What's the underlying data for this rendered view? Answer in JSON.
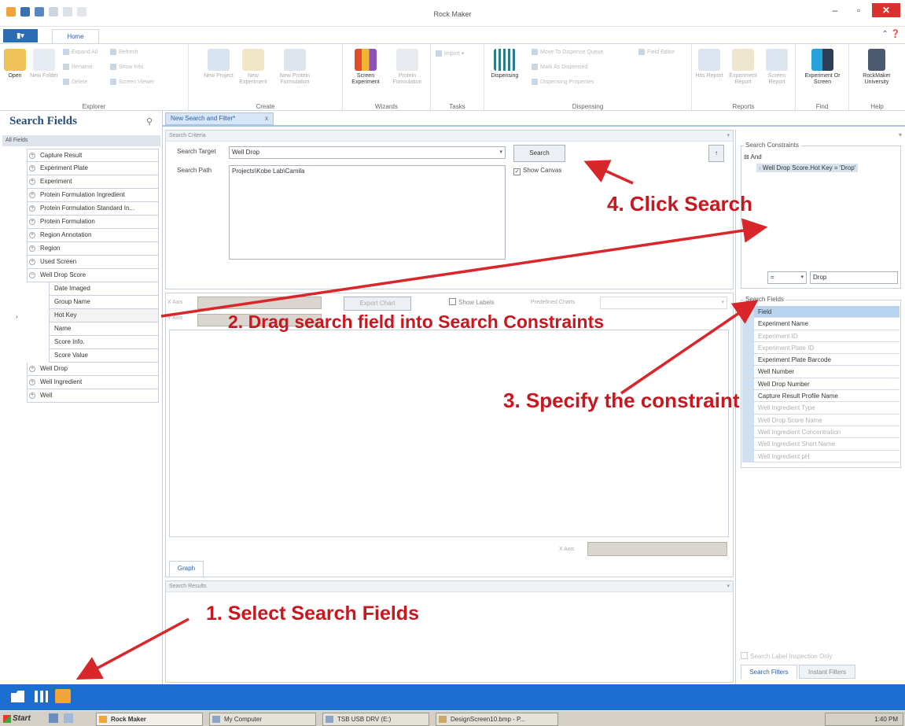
{
  "window": {
    "title": "Rock Maker"
  },
  "ribbon": {
    "file_tab": "",
    "home_tab": "Home",
    "groups": [
      {
        "label": "Explorer"
      },
      {
        "label": "Create"
      },
      {
        "label": "Wizards"
      },
      {
        "label": "Tasks"
      },
      {
        "label": "Dispensing"
      },
      {
        "label": "Reports"
      },
      {
        "label": "Find"
      },
      {
        "label": "Help"
      }
    ],
    "buttons": {
      "open": "Open",
      "new_folder": "New Folder",
      "expand_all": "Expand All",
      "refresh": "Refresh",
      "rename": "Rename",
      "show_info": "Show Info",
      "delete": "Delete",
      "screen_viewer": "Screen Viewer",
      "new_project": "New Project",
      "new_experiment": "New Experiment",
      "new_protein_formulation": "New Protein Formulation",
      "screen_experiment": "Screen Experiment",
      "protein_formulation": "Protein Formulation",
      "import": "Import",
      "dispensing": "Dispensing",
      "move_to_dispense_queue": "Move To Dispense Queue",
      "mark_as_dispensed": "Mark As Dispensed",
      "dispensing_properties": "Dispensing Properties",
      "field_editor": "Field Editor",
      "hits_report": "Hits Report",
      "experiment_report": "Experiment Report",
      "screen_report": "Screen Report",
      "experiment_or_screen": "Experiment Or Screen",
      "rockmaker_university": "RockMaker University"
    }
  },
  "left_pane": {
    "title": "Search Fields",
    "all_fields": "All Fields",
    "items": [
      "Capture Result",
      "Experiment Plate",
      "Experiment",
      "Protein Formulation Ingredient",
      "Protein Formulation Standard In...",
      "Protein Formulation",
      "Region Annotation",
      "Region",
      "Used Screen",
      "Well Drop Score"
    ],
    "children": [
      "Date Imaged",
      "Group Name",
      "Hot Key",
      "Name",
      "Score Info.",
      "Score Value"
    ],
    "items_after": [
      "Well Drop",
      "Well Ingredient",
      "Well"
    ]
  },
  "doc_tab": {
    "label": "New Search and Filter*",
    "close": "x"
  },
  "criteria": {
    "header": "Search Criteria",
    "target_label": "Search Target",
    "target_value": "Well Drop",
    "path_label": "Search Path",
    "path_value": "Projects\\Kobe Lab\\Camila",
    "search_button": "Search",
    "show_canvas": "Show Canvas"
  },
  "graph": {
    "x_axis": "X Axis",
    "y_axis": "Y Axis",
    "export_chart": "Export Chart",
    "show_labels": "Show Labels",
    "predefined_charts": "Predefined Charts",
    "x_axis_bottom": "X Axis",
    "tab": "Graph"
  },
  "results": {
    "header": "Search Results"
  },
  "constraints": {
    "legend": "Search Constraints",
    "root": "And",
    "item": "Well Drop Score.Hot Key = 'Drop'",
    "operator": "=",
    "value": "Drop"
  },
  "search_fields": {
    "legend": "Search Fields",
    "rows": [
      "Field",
      "Experiment Name",
      "Experiment ID",
      "Experiment Plate ID",
      "Experiment Plate Barcode",
      "Well Number",
      "Well Drop Number",
      "Capture Result Profile Name",
      "Well Ingredient Type",
      "Well Drop Score Name",
      "Well Ingredient Concentration",
      "Well Ingredient Short Name",
      "Well Ingredient pH"
    ],
    "search_labels": "Search Label Inspection Only",
    "tab_filters": "Search Filters",
    "tab_instant": "Instant Filters"
  },
  "annotations": {
    "step1": "1. Select Search Fields",
    "step2": "2. Drag search field into Search Constraints",
    "step3": "3. Specify the constraint",
    "step4": "4. Click Search"
  },
  "taskbar": {
    "start": "Start",
    "items": [
      "Rock Maker",
      "My Computer",
      "TSB USB DRV (E:)",
      "DesignScreen10.bmp - P..."
    ],
    "clock": "1:40 PM"
  },
  "colors": {
    "accent": "#1c6fd0",
    "annotation": "#c8171e"
  }
}
